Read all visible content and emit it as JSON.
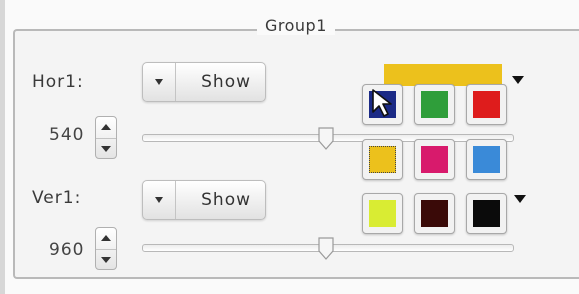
{
  "group": {
    "title": "Group1"
  },
  "horizontal": {
    "label": "Hor1:",
    "visibility": "Show",
    "value": "540",
    "slider_fraction": 0.5
  },
  "vertical": {
    "label": "Ver1:",
    "visibility": "Show",
    "value": "960",
    "slider_fraction": 0.5
  },
  "palette": {
    "current_color": "#ecc11c",
    "swatches": [
      {
        "name": "navy",
        "color": "#1b2a86"
      },
      {
        "name": "green",
        "color": "#2f9e3a"
      },
      {
        "name": "red",
        "color": "#de1c1c"
      },
      {
        "name": "yellow",
        "color": "#ecc11c",
        "selected": true
      },
      {
        "name": "magenta",
        "color": "#d81a6c"
      },
      {
        "name": "blue",
        "color": "#3a8ad8"
      },
      {
        "name": "lime",
        "color": "#d9ec33"
      },
      {
        "name": "maroon",
        "color": "#3a0a08"
      },
      {
        "name": "black",
        "color": "#0b0b0b"
      }
    ]
  },
  "icons": {
    "dropdown": "chevron-down-icon",
    "spin_up": "arrow-up-icon",
    "spin_down": "arrow-down-icon",
    "cursor": "mouse-pointer-icon"
  }
}
